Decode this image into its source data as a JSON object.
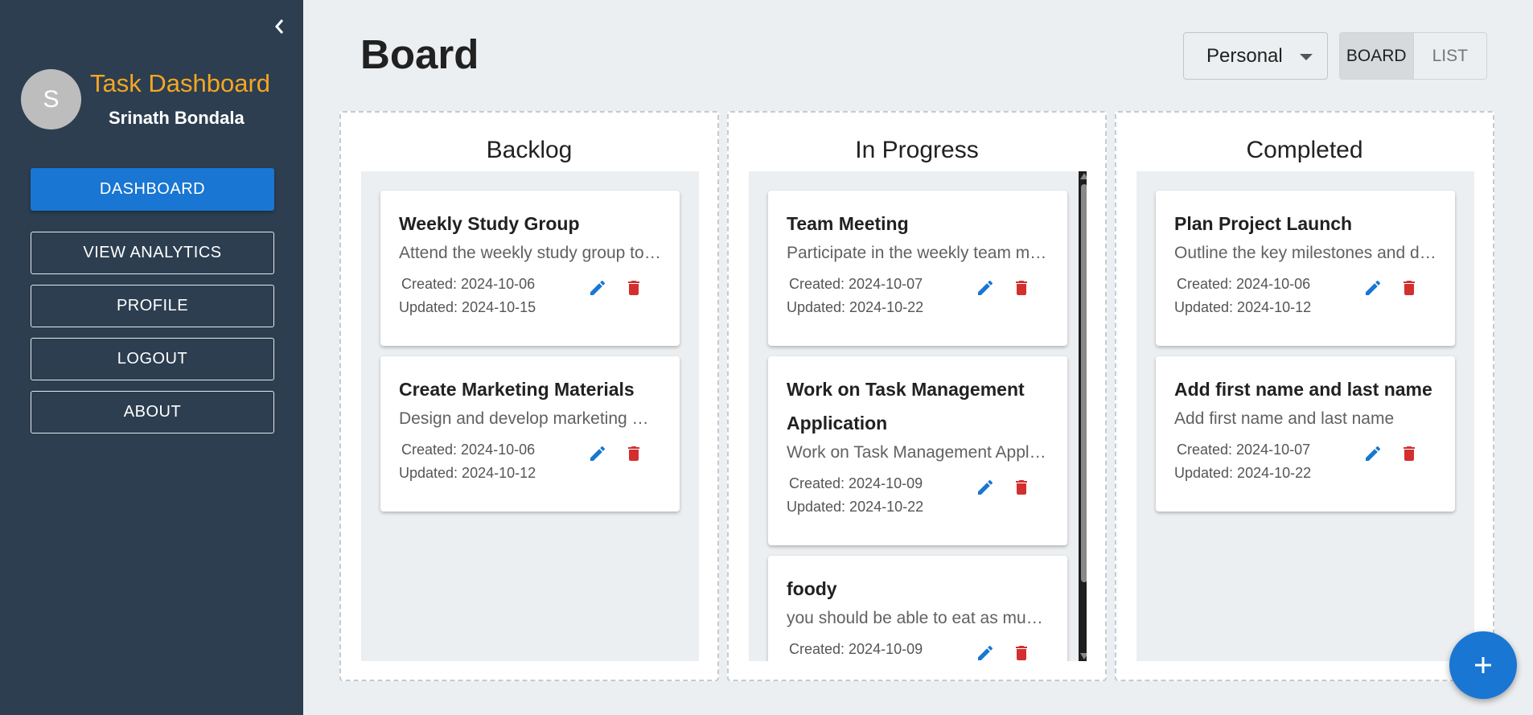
{
  "sidebar": {
    "avatar_letter": "S",
    "app_title": "Task Dashboard",
    "user_name": "Srinath Bondala",
    "nav": [
      {
        "label": "DASHBOARD",
        "active": true
      },
      {
        "label": "VIEW ANALYTICS",
        "active": false
      },
      {
        "label": "PROFILE",
        "active": false
      },
      {
        "label": "LOGOUT",
        "active": false
      },
      {
        "label": "ABOUT",
        "active": false
      }
    ]
  },
  "header": {
    "title": "Board",
    "workspace_select": "Personal",
    "view_toggle": {
      "board": "BOARD",
      "list": "LIST",
      "selected": "BOARD"
    }
  },
  "columns": [
    {
      "title": "Backlog",
      "cards": [
        {
          "title": "Weekly Study Group",
          "description": "Attend the weekly study group to discuss topics",
          "created": "Created: 2024-10-06",
          "updated": "Updated: 2024-10-15"
        },
        {
          "title": "Create Marketing Materials",
          "description": "Design and develop marketing materials for the launch",
          "created": "Created: 2024-10-06",
          "updated": "Updated: 2024-10-12"
        }
      ]
    },
    {
      "title": "In Progress",
      "cards": [
        {
          "title": "Team Meeting",
          "description": "Participate in the weekly team meeting",
          "created": "Created: 2024-10-07",
          "updated": "Updated: 2024-10-22"
        },
        {
          "title": "Work on Task Management Application",
          "description": "Work on Task Management Application features",
          "created": "Created: 2024-10-09",
          "updated": "Updated: 2024-10-22"
        },
        {
          "title": "foody",
          "description": "you should be able to eat as much as you want",
          "created": "Created: 2024-10-09",
          "updated": ""
        }
      ]
    },
    {
      "title": "Completed",
      "cards": [
        {
          "title": "Plan Project Launch",
          "description": "Outline the key milestones and deliverables",
          "created": "Created: 2024-10-06",
          "updated": "Updated: 2024-10-12"
        },
        {
          "title": "Add first name and last name",
          "description": "Add first name and last name",
          "created": "Created: 2024-10-07",
          "updated": "Updated: 2024-10-22"
        }
      ]
    }
  ],
  "icons": {
    "collapse": "chevron-left-icon",
    "edit": "pencil-icon",
    "delete": "trash-icon",
    "add": "plus-icon"
  },
  "colors": {
    "sidebar_bg": "#2c3e50",
    "accent": "#1976d2",
    "app_title": "#f5a623",
    "delete": "#d32f2f"
  }
}
